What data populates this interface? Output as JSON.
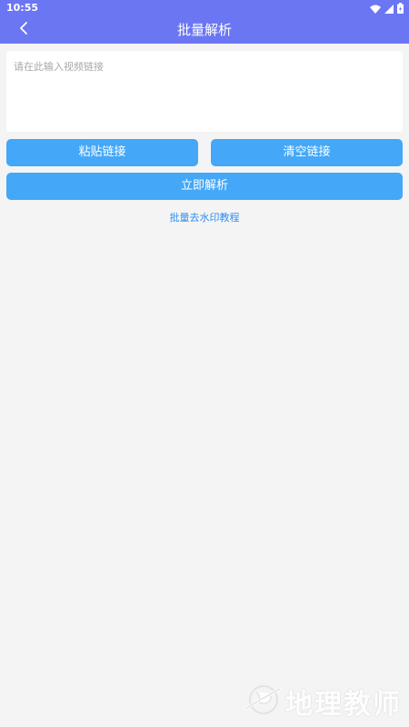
{
  "status_bar": {
    "time": "10:55"
  },
  "header": {
    "title": "批量解析",
    "back_icon": "chevron-left-icon"
  },
  "input": {
    "value": "",
    "placeholder": "请在此输入视频链接"
  },
  "buttons": {
    "paste_label": "粘贴链接",
    "clear_label": "清空链接",
    "parse_label": "立即解析"
  },
  "tutorial_link": "批量去水印教程",
  "watermark": {
    "text": "地理教师"
  },
  "colors": {
    "app_bar": "#6b76f2",
    "button": "#44a7f7",
    "link": "#2f8ff0",
    "background": "#f4f4f4"
  }
}
